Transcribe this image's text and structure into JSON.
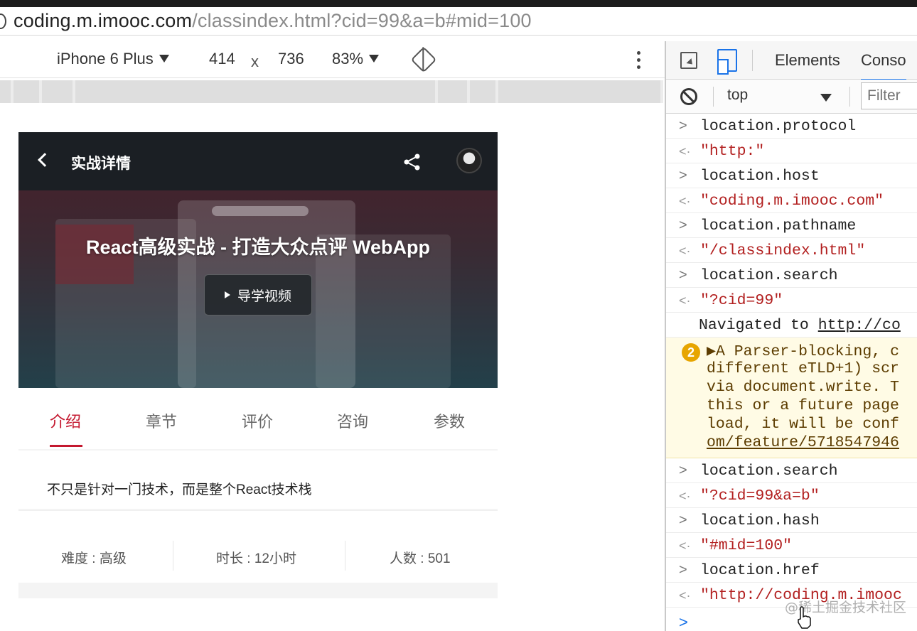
{
  "browser": {
    "url_host": "coding.m.imooc.com",
    "url_rest": "/classindex.html?cid=99&a=b#mid=100"
  },
  "device_toolbar": {
    "device": "iPhone 6 Plus",
    "width": "414",
    "times": "x",
    "height": "736",
    "zoom": "83%"
  },
  "page": {
    "nav_title": "实战详情",
    "course_title": "React高级实战 - 打造大众点评 WebApp",
    "video_button": "导学视频",
    "tabs": [
      {
        "label": "介绍",
        "active": true
      },
      {
        "label": "章节",
        "active": false
      },
      {
        "label": "评价",
        "active": false
      },
      {
        "label": "咨询",
        "active": false
      },
      {
        "label": "参数",
        "active": false
      }
    ],
    "intro": "不只是针对一门技术，而是整个React技术栈",
    "stats": {
      "difficulty": "难度 : 高级",
      "duration": "时长 : 12小时",
      "students": "人数 : 501"
    },
    "accent_color": "#c4182f"
  },
  "devtools": {
    "tabs": [
      "Elements",
      "Conso"
    ],
    "context": "top",
    "filter_placeholder": "Filter",
    "console": {
      "entries": [
        {
          "kind": "input",
          "prefix": ">",
          "text": "location.protocol"
        },
        {
          "kind": "output",
          "prefix": "<·",
          "text": "\"http:\""
        },
        {
          "kind": "input",
          "prefix": ">",
          "text": "location.host"
        },
        {
          "kind": "output",
          "prefix": "<·",
          "text": "\"coding.m.imooc.com\""
        },
        {
          "kind": "input",
          "prefix": ">",
          "text": "location.pathname"
        },
        {
          "kind": "output",
          "prefix": "<·",
          "text": "\"/classindex.html\""
        },
        {
          "kind": "input",
          "prefix": ">",
          "text": "location.search"
        },
        {
          "kind": "output",
          "prefix": "<·",
          "text": "\"?cid=99\""
        }
      ],
      "navigated_prefix": "Navigated to ",
      "navigated_link": "http://co",
      "warning": {
        "count": "2",
        "lines": [
          "▶A Parser-blocking, c",
          "different eTLD+1) scr",
          "via document.write. T",
          "this or a future page",
          "load, it will be conf",
          "om/feature/5718547946"
        ]
      },
      "entries_after": [
        {
          "kind": "input",
          "prefix": ">",
          "text": "location.search"
        },
        {
          "kind": "output",
          "prefix": "<·",
          "text": "\"?cid=99&a=b\""
        },
        {
          "kind": "input",
          "prefix": ">",
          "text": "location.hash"
        },
        {
          "kind": "output",
          "prefix": "<·",
          "text": "\"#mid=100\""
        },
        {
          "kind": "input",
          "prefix": ">",
          "text": "location.href"
        },
        {
          "kind": "output",
          "prefix": "<·",
          "text": "\"http://coding.m.imooc"
        }
      ],
      "prompt": ">"
    }
  },
  "watermark": "@稀土掘金技术社区"
}
